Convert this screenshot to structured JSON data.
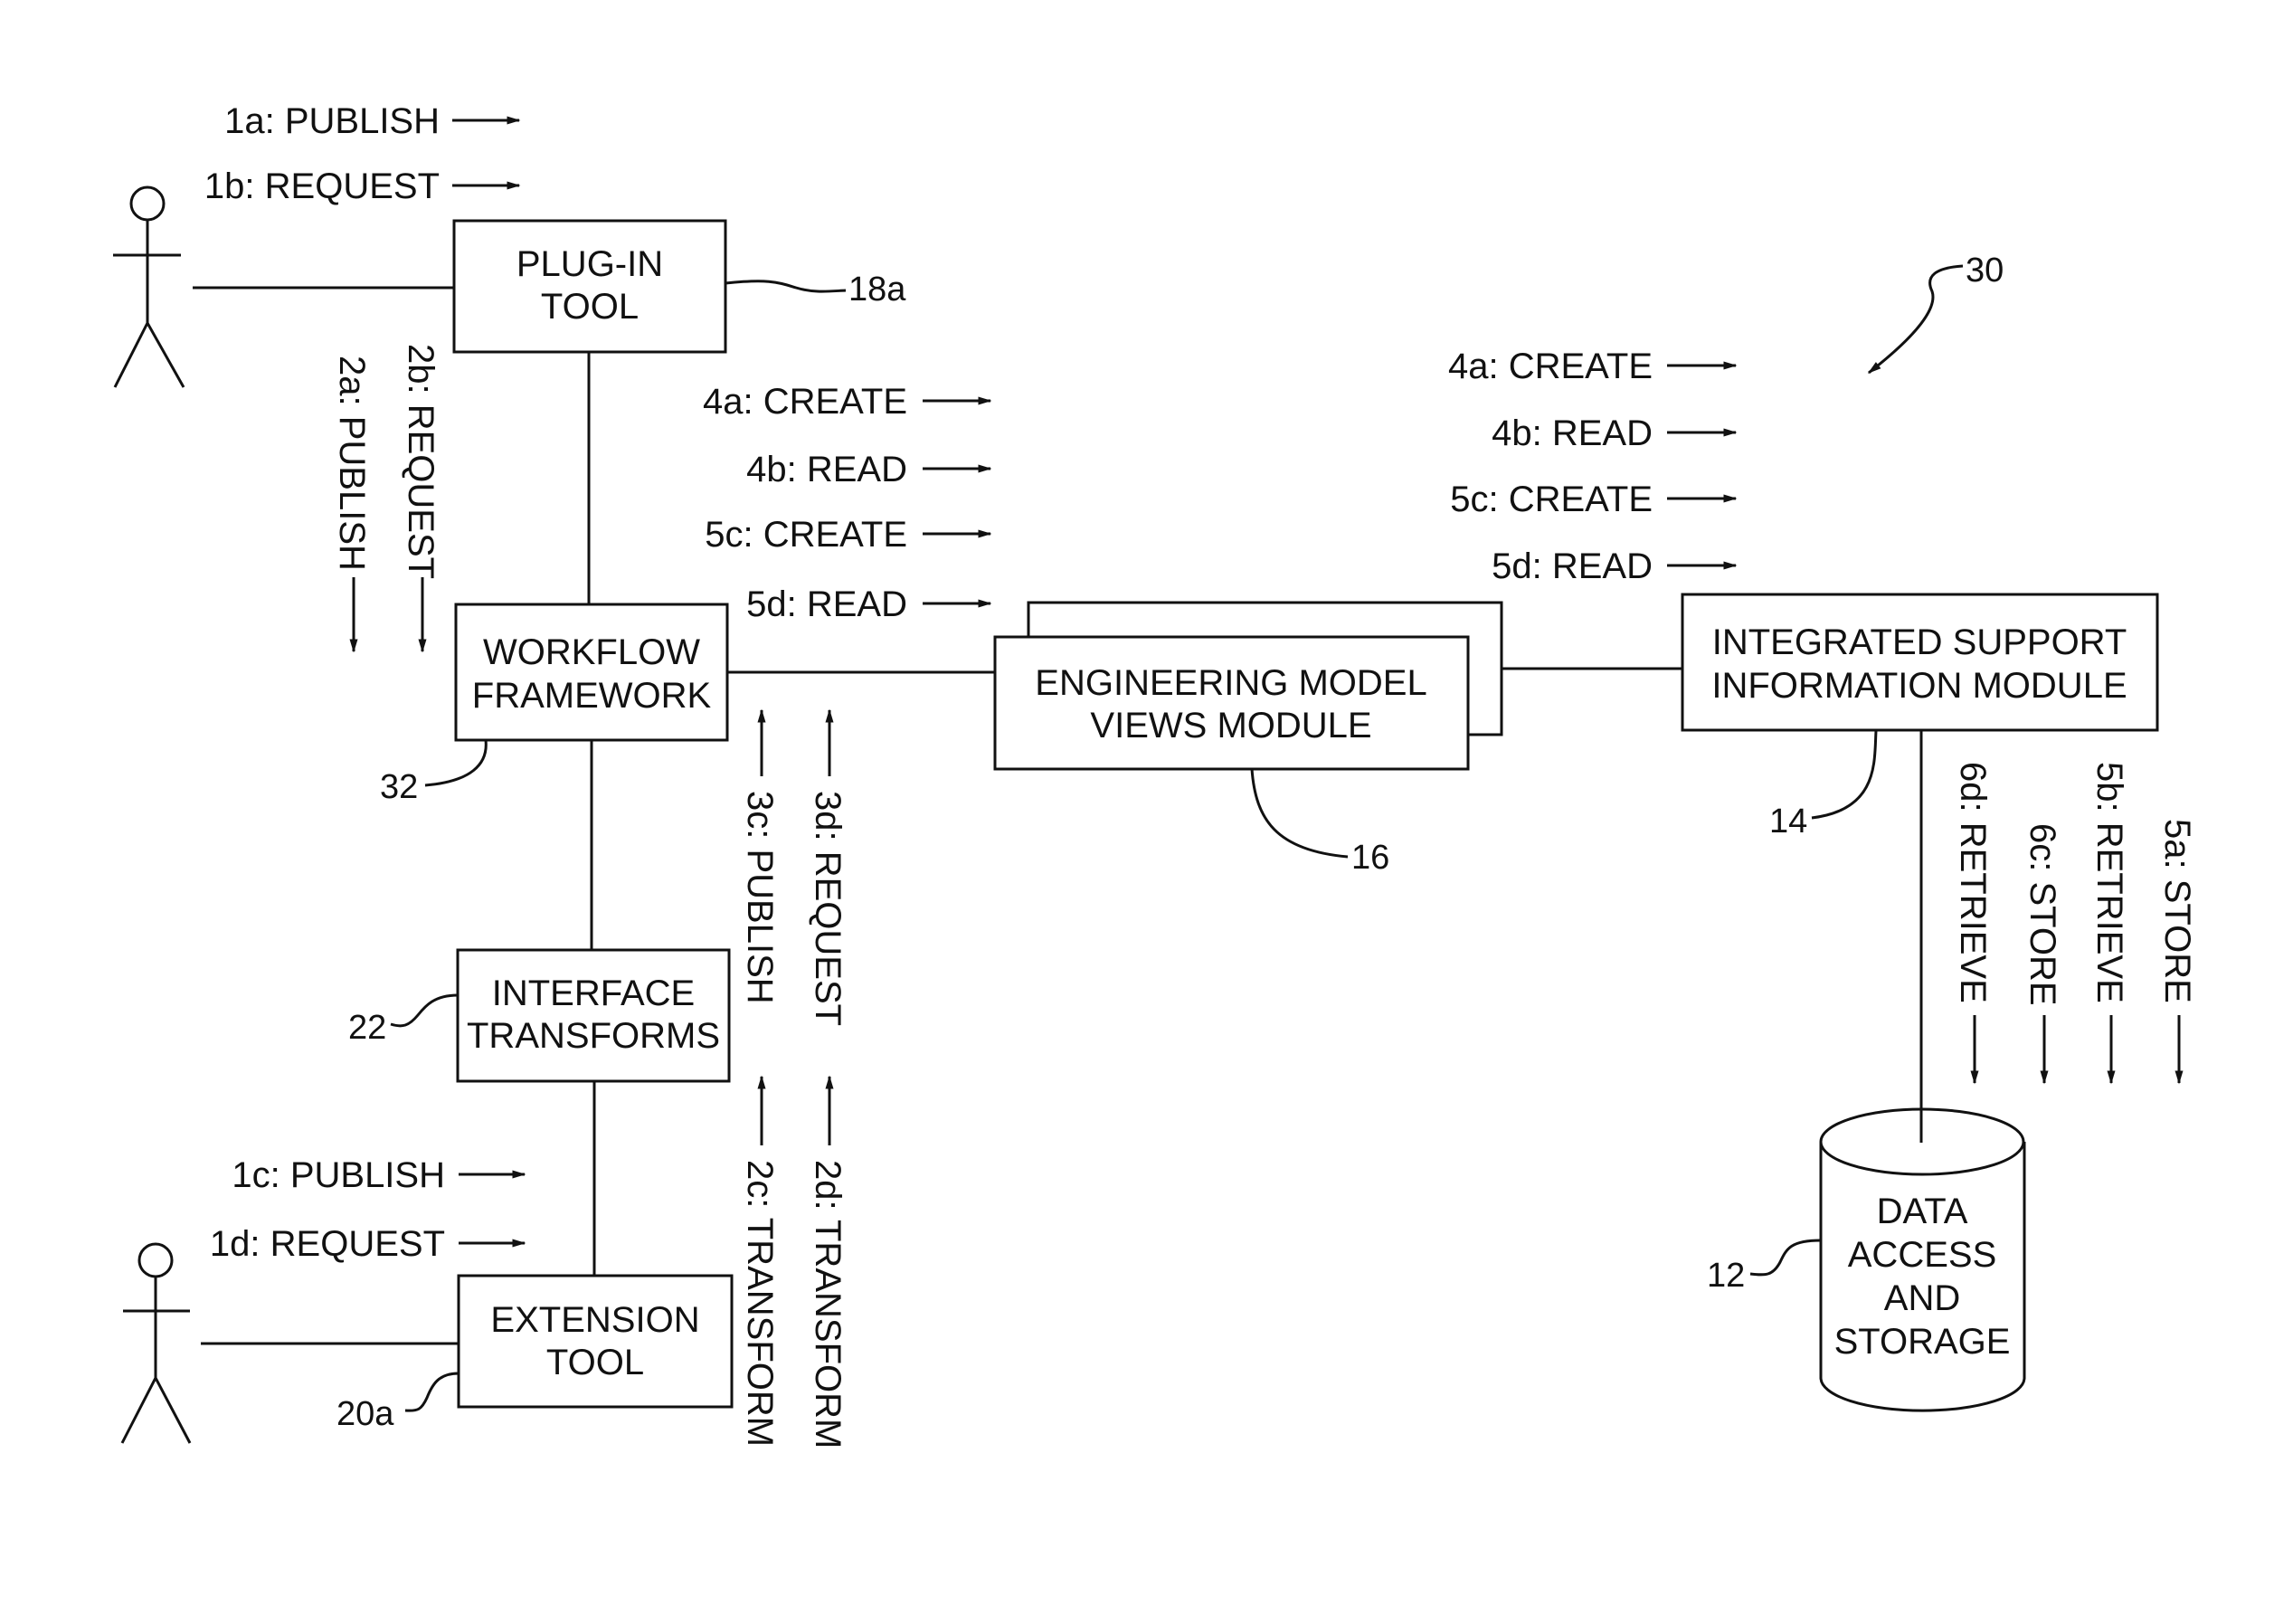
{
  "figure": {
    "reference_numeral": "30",
    "actors": [
      {
        "id": "user-top",
        "icon": "stick-figure-icon"
      },
      {
        "id": "user-bottom",
        "icon": "stick-figure-icon"
      }
    ],
    "boxes": {
      "plugin_tool": {
        "lines": [
          "PLUG-IN",
          "TOOL"
        ],
        "ref": "18a"
      },
      "workflow_framework": {
        "lines": [
          "WORKFLOW",
          "FRAMEWORK"
        ],
        "ref": "32"
      },
      "interface_transforms": {
        "lines": [
          "INTERFACE",
          "TRANSFORMS"
        ],
        "ref": "22"
      },
      "extension_tool": {
        "lines": [
          "EXTENSION",
          "TOOL"
        ],
        "ref": "20a"
      },
      "engineering_model_views": {
        "lines": [
          "ENGINEERING MODEL",
          "VIEWS MODULE"
        ],
        "ref": "16"
      },
      "integrated_support": {
        "lines": [
          "INTEGRATED SUPPORT",
          "INFORMATION MODULE"
        ],
        "ref": "14"
      },
      "data_access_storage": {
        "lines": [
          "DATA",
          "ACCESS",
          "AND",
          "STORAGE"
        ],
        "ref": "12",
        "shape": "cylinder"
      }
    },
    "messages": {
      "user_top": [
        "1a: PUBLISH",
        "1b: REQUEST"
      ],
      "plugin_to_workflow": [
        "2a: PUBLISH",
        "2b: REQUEST"
      ],
      "workflow_to_emv": [
        "4a: CREATE",
        "4b: READ",
        "5c: CREATE",
        "5d: READ"
      ],
      "emv_to_isim": [
        "4a: CREATE",
        "4b: READ",
        "5c: CREATE",
        "5d: READ"
      ],
      "transforms_to_workflow": [
        "3c: PUBLISH",
        "3d: REQUEST"
      ],
      "extension_to_transforms": [
        "2c: TRANSFORM",
        "2d: TRANSFORM"
      ],
      "user_bottom": [
        "1c: PUBLISH",
        "1d: REQUEST"
      ],
      "isim_to_storage": [
        "6d: RETRIEVE",
        "6c: STORE",
        "5b: RETRIEVE",
        "5a: STORE"
      ]
    }
  }
}
